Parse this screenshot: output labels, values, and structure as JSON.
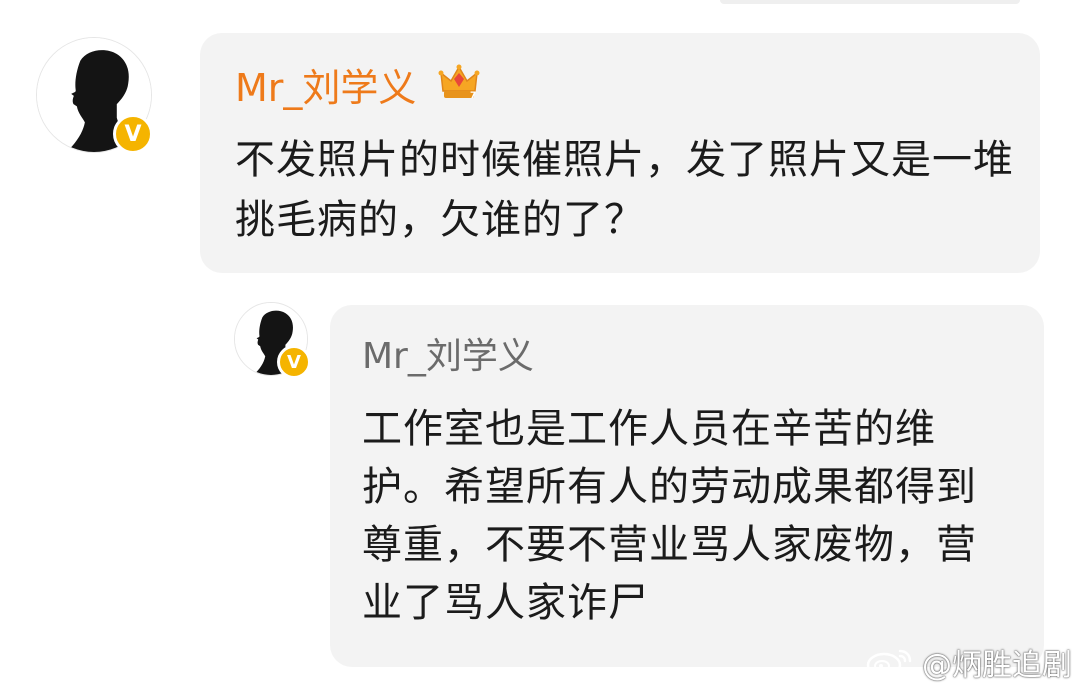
{
  "main_comment": {
    "username": "Mr_刘学义",
    "verified_badge": "V",
    "crown_icon": "crown-icon",
    "text": "不发照片的时候催照片，发了照片又是一堆挑毛病的，欠谁的了？"
  },
  "reply_comment": {
    "username": "Mr_刘学义",
    "verified_badge": "V",
    "text": "工作室也是工作人员在辛苦的维护。希望所有人的劳动成果都得到尊重，不要不营业骂人家废物，营业了骂人家诈尸"
  },
  "watermark": {
    "text": "@炳胜追剧",
    "icon": "weibo-icon"
  },
  "colors": {
    "username_vip": "#ee7a1a",
    "username_normal": "#6b6b6b",
    "badge": "#f5b400",
    "bubble": "#f3f3f3"
  }
}
